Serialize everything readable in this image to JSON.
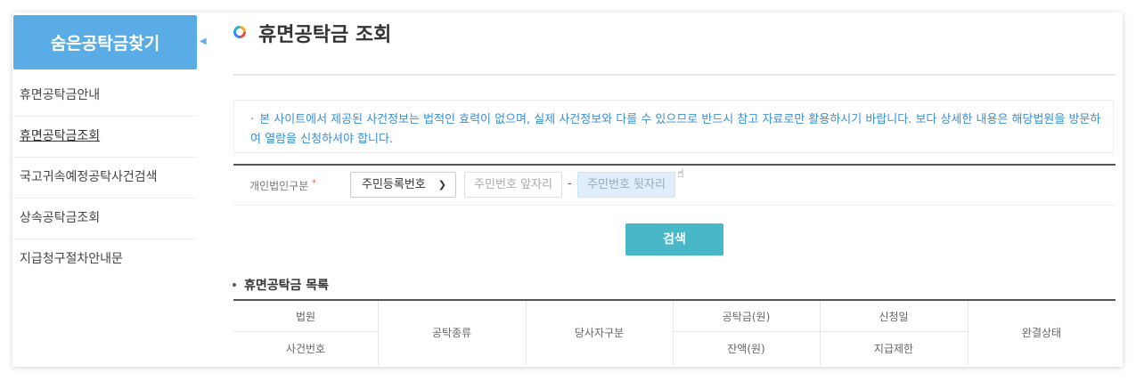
{
  "sidebar": {
    "header": "숨은공탁금찾기",
    "items": [
      {
        "label": "휴면공탁금안내"
      },
      {
        "label": "휴면공탁금조회"
      },
      {
        "label": "국고귀속예정공탁사건검색"
      },
      {
        "label": "상속공탁금조회"
      },
      {
        "label": "지급청구절차안내문"
      }
    ]
  },
  "page": {
    "title": "휴면공탁금 조회"
  },
  "notice": {
    "text": "본 사이트에서 제공된 사건정보는 법적인 효력이 없으며, 실제 사건정보와 다를 수 있으므로 반드시 참고 자료로만 활용하시기 바랍니다. 보다 상세한 내용은 해당법원을 방문하여 열람을 신청하셔야 합니다."
  },
  "form": {
    "label": "개인법인구분",
    "required_mark": "*",
    "select_value": "주민등록번호",
    "front_placeholder": "주민번호 앞자리",
    "dash": "-",
    "back_placeholder": "주민번호 뒷자리",
    "search_label": "검색"
  },
  "list": {
    "title": "휴면공탁금 목록",
    "headers": {
      "court": "법원",
      "case_no": "사건번호",
      "deposit_type": "공탁종류",
      "party_type": "당사자구분",
      "amount": "공탁금(원)",
      "balance": "잔액(원)",
      "apply_date": "신청일",
      "pay_limit": "지급제한",
      "status": "완결상태"
    }
  },
  "colors": {
    "sidebar_header": "#5aace6",
    "notice_text": "#3a8fd6",
    "search_button": "#48b8c9"
  }
}
